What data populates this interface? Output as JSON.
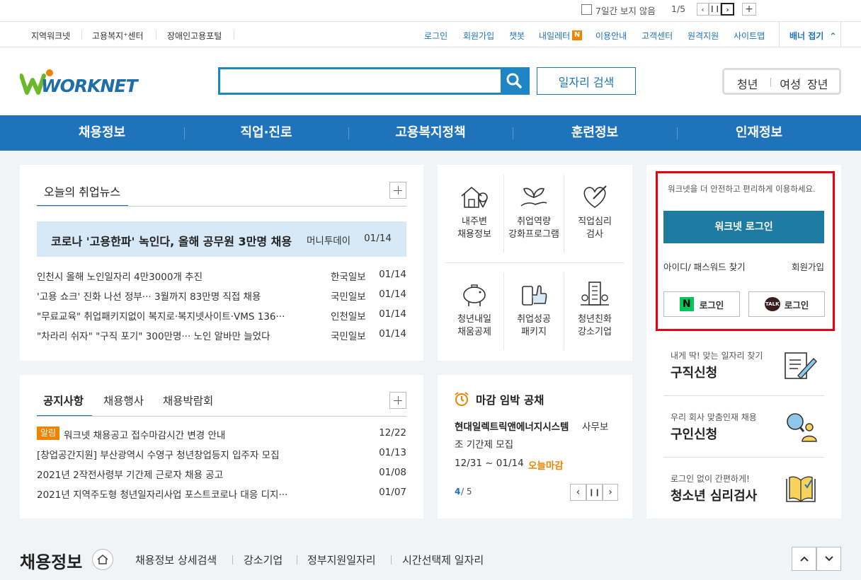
{
  "top_banner": {
    "no_show_label": "7일간 보지 않음",
    "pager": "1/5"
  },
  "util_left": [
    "지역워크넷",
    "고용복지⁺센터",
    "장애인고용포털"
  ],
  "util_right": [
    "로그인",
    "회원가입",
    "챗봇",
    "내일레터",
    "이용안내",
    "고객센터",
    "원격지원",
    "사이트맵"
  ],
  "util_badge": "N",
  "banner_fold": "배너 접기",
  "logo": "WORKNET",
  "search": {
    "placeholder": "",
    "button": "일자리 검색"
  },
  "audience": [
    "청년",
    "여성",
    "장년"
  ],
  "gnb": [
    "채용정보",
    "직업·진로",
    "고용복지정책",
    "훈련정보",
    "인재정보"
  ],
  "news": {
    "tab": "오늘의 취업뉴스",
    "highlight": {
      "title": "코로나 '고용한파' 녹인다, 올해 공무원 3만명 채용",
      "source": "머니투데이",
      "date": "01/14"
    },
    "items": [
      {
        "title": "인천시 올해 노인일자리 4만3000개 추진",
        "source": "한국일보",
        "date": "01/14"
      },
      {
        "title": "'고용 쇼크' 진화 나선 정부··· 3월까지 83만명 직접 채용",
        "source": "국민일보",
        "date": "01/14"
      },
      {
        "title": "\"무료교육\" 취업패키지없이 복지로·복지넷사이트·VMS 136···",
        "source": "인천일보",
        "date": "01/14"
      },
      {
        "title": "\"차라리 쉬자\" \"구직 포기\" 300만명··· 노인 알바만 늘었다",
        "source": "국민일보",
        "date": "01/14"
      }
    ]
  },
  "services": [
    [
      "내주변",
      "채용정보"
    ],
    [
      "취업역량",
      "강화프로그램"
    ],
    [
      "직업심리",
      "검사"
    ],
    [
      "청년내일",
      "채움공제"
    ],
    [
      "취업성공",
      "패키지"
    ],
    [
      "청년친화",
      "강소기업"
    ]
  ],
  "login": {
    "message": "워크넷을 더 안전하고 편리하게 이용하세요.",
    "button": "워크넷 로그인",
    "find": "아이디/ 패스워드 찾기",
    "join": "회원가입",
    "naver": "로그인",
    "kakao": "로그인",
    "naver_badge": "N",
    "kakao_badge": "TALK"
  },
  "notice": {
    "tabs": [
      "공지사항",
      "채용행사",
      "채용박람회"
    ],
    "badge": "알림",
    "items": [
      {
        "title": "워크넷 채용공고 접수마감시간 변경 안내",
        "date": "12/22"
      },
      {
        "title": "[창업공간지원] 부산광역시 수영구 청년창업등지 입주자 모집",
        "date": "01/13"
      },
      {
        "title": "2021년 2작전사령부 기간제 근로자 채용 공고",
        "date": "01/08"
      },
      {
        "title": "2021년 지역주도형 청년일자리사업 포스트코로나 대응 디지···",
        "date": "01/07"
      }
    ]
  },
  "deadline": {
    "title": "마감 임박 공채",
    "company": "현대일렉트릭앤에너지시스템",
    "job_line1": "사무보",
    "job_line2": "조 기간제 모집",
    "period": "12/31 ~ 01/14",
    "tag": "오늘마감",
    "page": "4",
    "total": "/ 5"
  },
  "shortcuts": [
    {
      "sub": "내게 딱! 맞는 일자리 찾기",
      "title": "구직신청"
    },
    {
      "sub": "우리 회사 맞춤인재 채용",
      "title": "구인신청"
    },
    {
      "sub": "로그인 없이 간편하게!",
      "title": "청소년 심리검사"
    }
  ],
  "section": {
    "title": "채용정보",
    "links": [
      "채용정보 상세검색",
      "강소기업",
      "정부지원일자리",
      "시간선택제 일자리"
    ]
  },
  "colors": {
    "primary": "#1e73ba",
    "login": "#1d7aa1",
    "red": "#e60012",
    "orange": "#f08300"
  }
}
